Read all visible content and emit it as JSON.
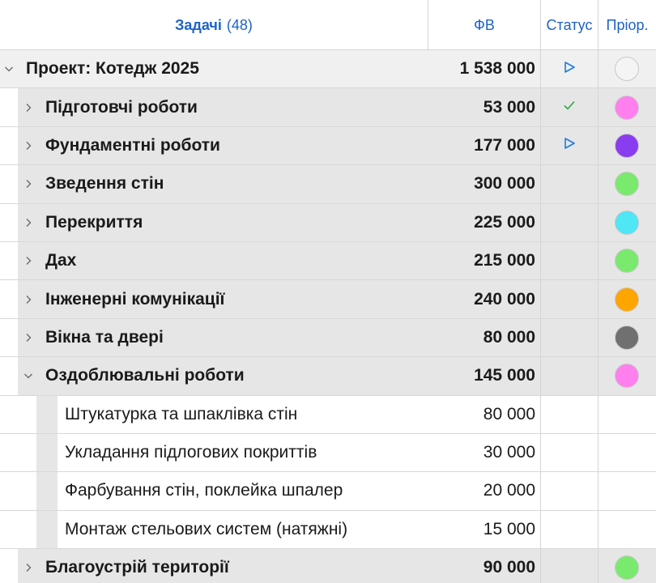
{
  "header": {
    "task_label": "Задачі",
    "task_count": "(48)",
    "fv_label": "ФВ",
    "status_label": "Статус",
    "priority_label": "Пріор."
  },
  "colors": {
    "header_text": "#1e62c6",
    "status_play": "#1e7be0",
    "status_done": "#2aa84a"
  },
  "rows": [
    {
      "level": 0,
      "expanded": true,
      "name": "Проект: Котедж 2025",
      "fv": "1 538 000",
      "status": "play-icon",
      "priority": "#f4f4f4"
    },
    {
      "level": 1,
      "expanded": false,
      "name": "Підготовчі роботи",
      "fv": "53 000",
      "status": "check-icon",
      "priority": "#ff7fef"
    },
    {
      "level": 1,
      "expanded": false,
      "name": "Фундаментні роботи",
      "fv": "177 000",
      "status": "play-icon",
      "priority": "#8a3cf0"
    },
    {
      "level": 1,
      "expanded": false,
      "name": "Зведення стін",
      "fv": "300 000",
      "status": "",
      "priority": "#7aea6f"
    },
    {
      "level": 1,
      "expanded": false,
      "name": "Перекриття",
      "fv": "225 000",
      "status": "",
      "priority": "#4fe6f6"
    },
    {
      "level": 1,
      "expanded": false,
      "name": "Дах",
      "fv": "215 000",
      "status": "",
      "priority": "#7aea6f"
    },
    {
      "level": 1,
      "expanded": false,
      "name": "Інженерні комунікації",
      "fv": "240 000",
      "status": "",
      "priority": "#ffa500"
    },
    {
      "level": 1,
      "expanded": false,
      "name": "Вікна та двері",
      "fv": "80 000",
      "status": "",
      "priority": "#707070"
    },
    {
      "level": 1,
      "expanded": true,
      "name": "Оздоблювальні роботи",
      "fv": "145 000",
      "status": "",
      "priority": "#ff7fef"
    },
    {
      "level": 2,
      "expanded": false,
      "name": "Штукатурка та шпаклівка стін",
      "fv": "80 000",
      "status": "",
      "priority": ""
    },
    {
      "level": 2,
      "expanded": false,
      "name": "Укладання підлогових покриттів",
      "fv": "30 000",
      "status": "",
      "priority": ""
    },
    {
      "level": 2,
      "expanded": false,
      "name": "Фарбування стін, поклейка шпалер",
      "fv": "20 000",
      "status": "",
      "priority": ""
    },
    {
      "level": 2,
      "expanded": false,
      "name": "Монтаж стельових систем (натяжні)",
      "fv": "15 000",
      "status": "",
      "priority": ""
    },
    {
      "level": 1,
      "expanded": false,
      "name": "Благоустрій території",
      "fv": "90 000",
      "status": "",
      "priority": "#7aea6f"
    }
  ]
}
